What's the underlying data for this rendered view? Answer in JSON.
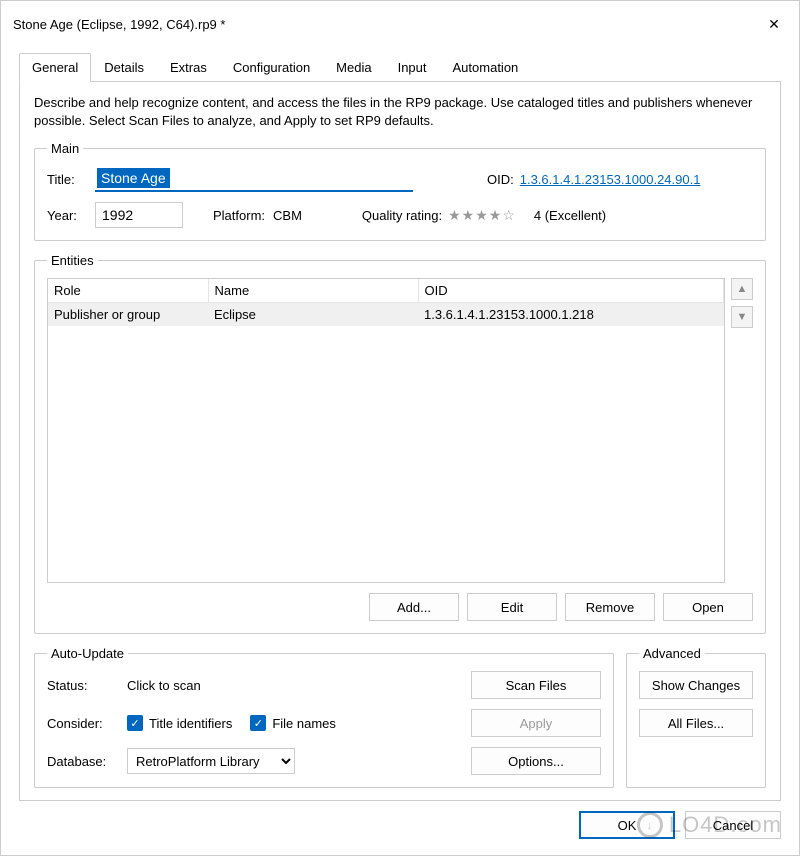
{
  "window": {
    "title": "Stone Age (Eclipse, 1992, C64).rp9 *"
  },
  "tabs": [
    "General",
    "Details",
    "Extras",
    "Configuration",
    "Media",
    "Input",
    "Automation"
  ],
  "activeTab": 0,
  "description": "Describe and help recognize content, and access the files in the RP9 package. Use cataloged titles and publishers whenever possible. Select Scan Files to analyze, and Apply to set RP9 defaults.",
  "main": {
    "legend": "Main",
    "titleLabel": "Title:",
    "titleValue": "Stone Age",
    "oidLabel": "OID:",
    "oidValue": "1.3.6.1.4.1.23153.1000.24.90.1",
    "yearLabel": "Year:",
    "yearValue": "1992",
    "platformLabel": "Platform:",
    "platformValue": "CBM",
    "qualityLabel": "Quality rating:",
    "qualityStars": "★★★★☆",
    "qualityText": "4 (Excellent)"
  },
  "entities": {
    "legend": "Entities",
    "columns": [
      "Role",
      "Name",
      "OID"
    ],
    "rows": [
      {
        "role": "Publisher or group",
        "name": "Eclipse",
        "oid": "1.3.6.1.4.1.23153.1000.1.218"
      }
    ],
    "buttons": {
      "add": "Add...",
      "edit": "Edit",
      "remove": "Remove",
      "open": "Open"
    }
  },
  "autoUpdate": {
    "legend": "Auto-Update",
    "statusLabel": "Status:",
    "statusValue": "Click to scan",
    "considerLabel": "Consider:",
    "chkTitle": "Title identifiers",
    "chkFile": "File names",
    "databaseLabel": "Database:",
    "databaseValue": "RetroPlatform Library",
    "scan": "Scan Files",
    "apply": "Apply",
    "options": "Options..."
  },
  "advanced": {
    "legend": "Advanced",
    "showChanges": "Show Changes",
    "allFiles": "All Files..."
  },
  "footer": {
    "ok": "OK",
    "cancel": "Cancel"
  },
  "watermark": "LO4D.com"
}
